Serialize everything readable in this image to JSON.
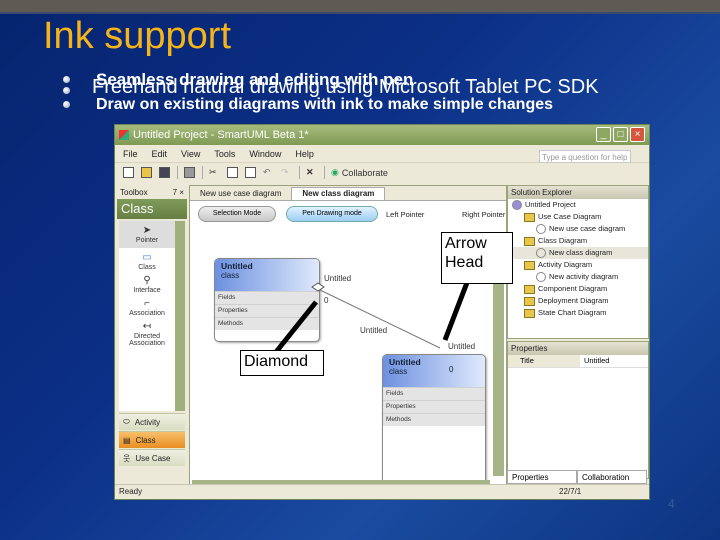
{
  "slide": {
    "title": "Ink support",
    "bullets": [
      "Seamless drawing and editing with pen",
      "Freehand natural drawing using Microsoft Tablet PC SDK",
      "Draw on existing diagrams with ink to make simple changes"
    ],
    "page_number": "4",
    "title_color": "#f5b418"
  },
  "window": {
    "title": "Untitled Project - SmartUML Beta 1*",
    "menu": [
      "File",
      "Edit",
      "View",
      "Tools",
      "Window",
      "Help"
    ],
    "help_placeholder": "Type a question for help",
    "collaborate_label": "Collaborate",
    "status": "Ready",
    "status_right": "22/7/1"
  },
  "toolbox": {
    "header": "Toolbox",
    "pin": "7",
    "close": "×",
    "category": "Class",
    "items": [
      {
        "label": "Pointer",
        "icon": "pointer-icon",
        "glyph": "➤"
      },
      {
        "label": "Class",
        "icon": "class-icon",
        "glyph": "▭"
      },
      {
        "label": "Interface",
        "icon": "interface-icon",
        "glyph": "⚲"
      },
      {
        "label": "Association",
        "icon": "association-icon",
        "glyph": "⌐"
      },
      {
        "label": "Directed Association",
        "icon": "directed-association-icon",
        "glyph": "↤"
      }
    ],
    "groups": [
      {
        "label": "Activity",
        "glyph": "⬭"
      },
      {
        "label": "Class",
        "glyph": "▤"
      },
      {
        "label": "Use Case",
        "glyph": "웃"
      }
    ]
  },
  "document": {
    "tabs": [
      "New use case diagram",
      "New class diagram"
    ],
    "active_tab": 1,
    "modes": [
      "Selection Mode",
      "Pen Drawing mode"
    ],
    "left_pointer": "Left Pointer",
    "right_pointer": "Right Pointer",
    "classes": [
      {
        "name": "Untitled",
        "stereo": "class",
        "rows": [
          "Fields",
          "Properties",
          "Methods"
        ]
      },
      {
        "name": "Untitled",
        "stereo": "class",
        "rows": [
          "Fields",
          "Properties",
          "Methods"
        ],
        "count": "0"
      }
    ],
    "labels": {
      "end1_name": "Untitled",
      "end1_mult": "0",
      "assoc_name": "Untitled",
      "end2_name": "Untitled"
    }
  },
  "solution_explorer": {
    "title": "Solution Explorer",
    "items": [
      {
        "label": "Untitled Project",
        "level": 0,
        "type": "project"
      },
      {
        "label": "Use Case Diagram",
        "level": 1,
        "type": "folder"
      },
      {
        "label": "New use case diagram",
        "level": 2,
        "type": "diagram"
      },
      {
        "label": "Class Diagram",
        "level": 1,
        "type": "folder"
      },
      {
        "label": "New class diagram",
        "level": 2,
        "type": "diagram"
      },
      {
        "label": "Activity Diagram",
        "level": 1,
        "type": "folder"
      },
      {
        "label": "New activity diagram",
        "level": 2,
        "type": "diagram"
      },
      {
        "label": "Component Diagram",
        "level": 1,
        "type": "folder"
      },
      {
        "label": "Deployment Diagram",
        "level": 1,
        "type": "folder"
      },
      {
        "label": "State Chart Diagram",
        "level": 1,
        "type": "folder"
      }
    ]
  },
  "properties": {
    "title": "Properties",
    "rows": [
      {
        "key": "Title",
        "value": "Untitled"
      }
    ],
    "tabs": [
      "Properties",
      "Collaboration"
    ]
  },
  "callouts": {
    "arrow_head": "Arrow Head",
    "arrow_head_l1": "Arrow",
    "arrow_head_l2": "Head",
    "diamond": "Diamond"
  }
}
